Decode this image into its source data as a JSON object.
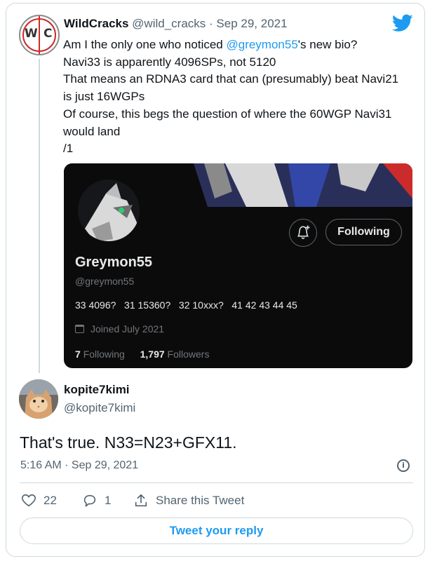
{
  "parent_tweet": {
    "avatar_letters": [
      "W",
      "C"
    ],
    "author_name": "WildCracks",
    "author_handle": "@wild_cracks",
    "date_sep": " · ",
    "date": "Sep 29, 2021",
    "body_lines": [
      {
        "pre": "Am I the only one who noticed ",
        "mention": "@greymon55",
        "post": "'s new bio?"
      },
      {
        "pre": "Navi33 is apparently 4096SPs, not 5120"
      },
      {
        "pre": "That means an RDNA3 card that can (presumably) beat Navi21"
      },
      {
        "pre": "is just 16WGPs"
      },
      {
        "pre": "Of course, this begs the question of where the 60WGP Navi31"
      },
      {
        "pre": "would land"
      },
      {
        "pre": "/1"
      }
    ]
  },
  "embedded_profile": {
    "follow_label": "Following",
    "display_name": "Greymon55",
    "handle": "@greymon55",
    "bio": "33 4096?   31 15360?   32 10xxx?   41 42 43 44 45",
    "joined": "Joined July 2021",
    "following_count": "7",
    "following_label": "Following",
    "followers_count": "1,797",
    "followers_label": "Followers"
  },
  "main_tweet": {
    "author_name": "kopite7kimi",
    "author_handle": "@kopite7kimi",
    "text": "That's true. N33=N23+GFX11.",
    "timestamp": "5:16 AM · Sep 29, 2021",
    "likes": "22",
    "replies": "1",
    "share_label": "Share this Tweet",
    "reply_button_label": "Tweet your reply"
  },
  "colors": {
    "accent": "#1d9bf0",
    "text_primary": "#0f1419",
    "text_secondary": "#536471",
    "border": "#cfd9de",
    "embed_bg": "#0b0b0b"
  },
  "icons": [
    "twitter-bird-icon",
    "bell-plus-icon",
    "calendar-icon",
    "info-icon",
    "heart-icon",
    "reply-bubble-icon",
    "share-icon"
  ]
}
